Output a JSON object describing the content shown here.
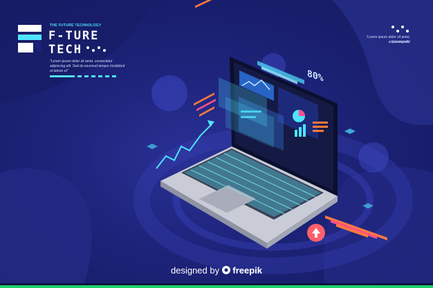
{
  "brand": {
    "tagline": "THE FUTURE TECHNOLOGY",
    "line1": "F-TURE",
    "line2": "TECH"
  },
  "intro_text": {
    "line1": "\"Lorem ipsum dolor sit amet, consectetur",
    "line2": "adipiscing elit. Sed do eiusmod tempor incididunt",
    "line3": "ut labore et\""
  },
  "side_text": {
    "line1": "\"Lorem ipsum dolor sit amet, consectetur",
    "line2": "adipiscing elit."
  },
  "screen": {
    "percent": "80%"
  },
  "credit": {
    "prefix": "designed by",
    "brand": "freepik"
  },
  "colors": {
    "background": "#1c2277",
    "accent_cyan": "#4fe3ff",
    "accent_orange": "#ff7a3d",
    "accent_pink": "#ff4f8b",
    "bottom_accent": "#1fd06b"
  },
  "icons": {
    "logo": "ft-logo-icon",
    "upload": "upload-icon"
  }
}
